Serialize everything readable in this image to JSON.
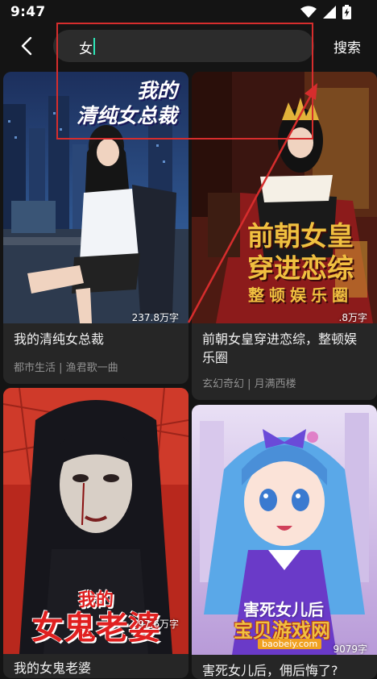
{
  "status_bar": {
    "time": "9:47"
  },
  "search": {
    "value": "女",
    "submit_label": "搜索"
  },
  "books": [
    {
      "title": "我的清纯女总裁",
      "meta": "都市生活 | 渔君歌一曲",
      "word_count": "237.8万字",
      "cover_caption": [
        "我的",
        "清纯女总裁"
      ]
    },
    {
      "title": "前朝女皇穿进恋综，整顿娱乐圈",
      "meta": "玄幻奇幻 | 月满西楼",
      "word_count": ".8万字",
      "cover_caption": [
        "前朝女皇",
        "穿进恋综",
        "整顿娱乐圈"
      ]
    },
    {
      "title": "我的女鬼老婆",
      "meta": "",
      "word_count": "97.6万字",
      "cover_caption": [
        "我的",
        "女鬼老婆"
      ]
    },
    {
      "title": "害死女儿后，佣后悔了?",
      "meta": "",
      "word_count": "9079字",
      "cover_caption": [
        "害死女儿后"
      ]
    }
  ],
  "watermark": {
    "big": "宝贝游戏网",
    "small": "baobeiy.com"
  },
  "colors": {
    "background": "#141414",
    "card": "#262626",
    "search_box": "#2c2c2c",
    "caret": "#2ee6b8",
    "annotation": "#d62d2d"
  }
}
